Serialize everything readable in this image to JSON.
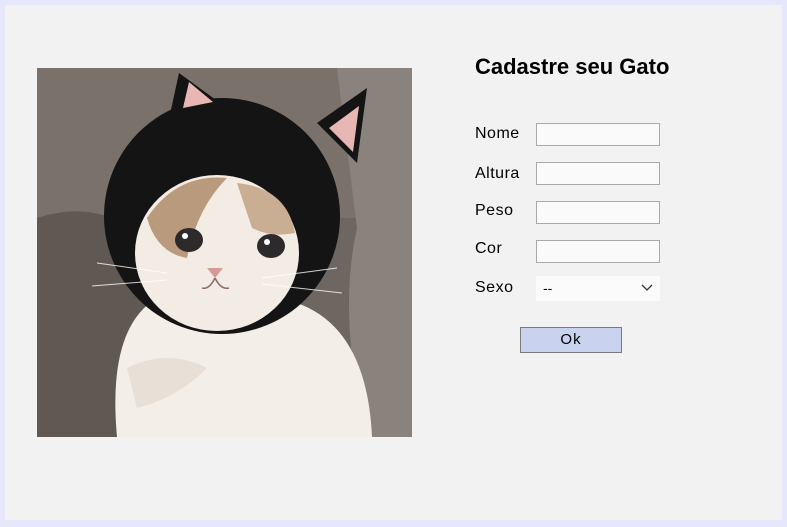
{
  "form": {
    "title": "Cadastre seu Gato",
    "fields": [
      {
        "label": "Nome",
        "value": ""
      },
      {
        "label": "Altura",
        "value": ""
      },
      {
        "label": "Peso",
        "value": ""
      },
      {
        "label": "Cor",
        "value": ""
      }
    ],
    "sexo": {
      "label": "Sexo",
      "selected": "--"
    },
    "submit_label": "Ok"
  },
  "photo": {
    "subject": "cat-in-black-knit-hood-photo"
  },
  "colors": {
    "page_border": "#e7e7fb",
    "panel_background": "#f2f2f2",
    "button_background": "#c9d3f0"
  }
}
